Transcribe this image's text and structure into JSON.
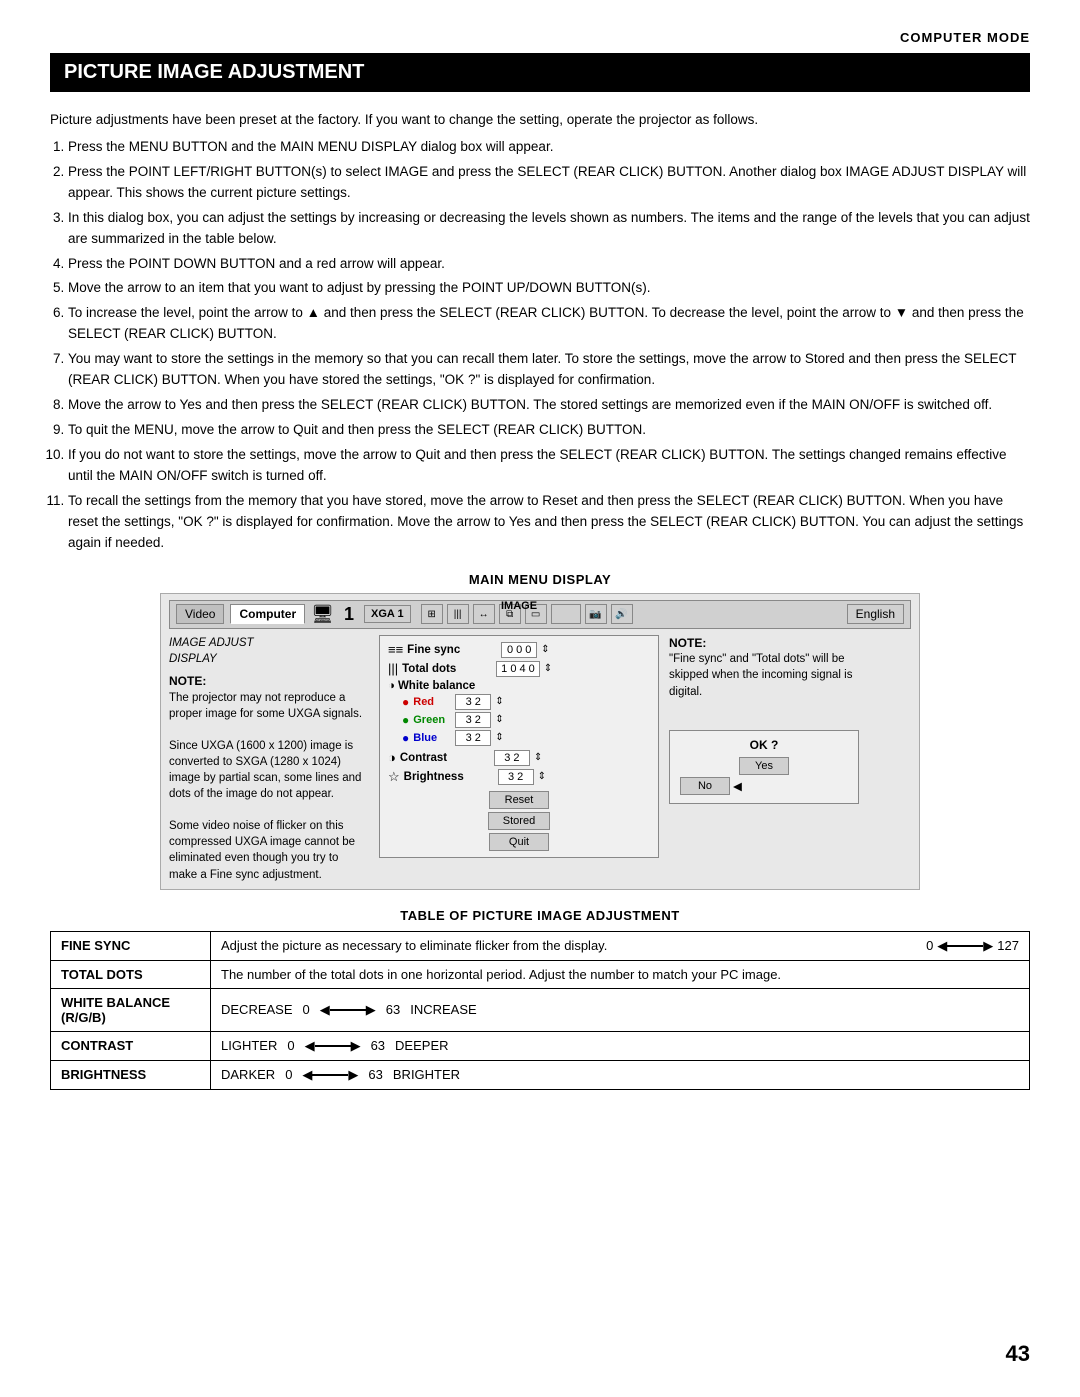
{
  "header": {
    "mode": "COMPUTER MODE"
  },
  "title": "PICTURE IMAGE ADJUSTMENT",
  "intro": "Picture adjustments have been preset at the factory.  If you want to change the setting, operate the projector as follows.",
  "steps": [
    "Press the MENU BUTTON and the MAIN MENU DISPLAY dialog box will appear.",
    "Press the POINT LEFT/RIGHT BUTTON(s) to select IMAGE and press the SELECT (REAR CLICK) BUTTON. Another dialog box IMAGE ADJUST DISPLAY will appear. This shows the current picture settings.",
    "In this dialog box, you can adjust the settings by increasing or decreasing the levels shown as numbers. The items and the range of the levels that you can adjust are summarized in the table below.",
    "Press the POINT DOWN BUTTON and a red arrow will appear.",
    "Move the arrow to an item that you want to adjust by pressing the POINT UP/DOWN BUTTON(s).",
    "To increase the level, point the arrow to ▲ and then press the SELECT (REAR CLICK) BUTTON. To decrease the level, point the arrow to ▼ and then press the SELECT (REAR CLICK) BUTTON.",
    "You may want to store the settings in the memory so that you can recall them later. To store the settings, move the arrow to Stored and then press the SELECT (REAR CLICK) BUTTON. When you have stored the settings, \"OK ?\" is displayed for confirmation.",
    "Move the arrow to Yes and then press the SELECT (REAR CLICK) BUTTON. The stored settings are memorized even if the MAIN ON/OFF is switched off.",
    "To quit the MENU, move the arrow to Quit and then press the SELECT (REAR CLICK) BUTTON.",
    "If you do not want to store the settings, move the arrow to Quit and then press the SELECT (REAR CLICK) BUTTON. The settings changed remains effective until the MAIN ON/OFF switch is turned off.",
    "To recall the settings from the memory that you have stored, move the arrow to Reset and then press the SELECT (REAR CLICK) BUTTON. When you have reset the settings, \"OK ?\" is displayed for confirmation. Move the arrow to Yes and then press  the SELECT (REAR CLICK) BUTTON. You can adjust the settings again if needed."
  ],
  "diagram": {
    "label": "MAIN MENU DISPLAY",
    "tabs": [
      "Video",
      "Computer"
    ],
    "active_tab": "Computer",
    "computer_num": "1",
    "xga": "XGA 1",
    "image_label": "IMAGE",
    "english": "English",
    "image_adjust_label": "IMAGE ADJUST\nDISPLAY",
    "adjust_items": [
      {
        "icon": "≡≡",
        "label": "Fine sync",
        "value": "0 0 0"
      },
      {
        "icon": "|||",
        "label": "Total dots",
        "value": "1 0 4 0"
      }
    ],
    "white_balance_label": "White balance",
    "wb_items": [
      {
        "color": "Red",
        "value": "3 2"
      },
      {
        "color": "Green",
        "value": "3 2"
      },
      {
        "color": "Blue",
        "value": "3 2"
      }
    ],
    "contrast": {
      "label": "Contrast",
      "value": "3 2"
    },
    "brightness": {
      "label": "Brightness",
      "value": "3 2"
    },
    "buttons": [
      "Reset",
      "Stored",
      "Quit"
    ],
    "ok_text": "OK ?",
    "yes_label": "Yes",
    "no_label": "No"
  },
  "left_note": {
    "title": "NOTE:",
    "text": "The projector may not reproduce a proper image for some UXGA signals.\nSince UXGA (1600 x 1200) image is converted to SXGA (1280 x 1024) image by partial scan, some lines and dots of the image do not appear.\nSome video noise of flicker on this compressed UXGA image cannot be eliminated even though you try to make a Fine sync adjustment."
  },
  "right_note": {
    "title": "NOTE:",
    "text": "\"Fine sync\" and \"Total dots\" will be skipped when the incoming signal is digital."
  },
  "table": {
    "label": "TABLE OF PICTURE IMAGE ADJUSTMENT",
    "rows": [
      {
        "header": "FINE SYNC",
        "desc": "Adjust the picture as necessary to eliminate flicker from the display.",
        "range_start": "0",
        "range_end": "127",
        "extra": ""
      },
      {
        "header": "TOTAL DOTS",
        "desc": "The number of the total dots in one horizontal period. Adjust the number to match your PC image.",
        "range_start": "",
        "range_end": "",
        "extra": ""
      },
      {
        "header": "WHITE BALANCE (R/G/B)",
        "desc": "DECREASE",
        "range_start": "0",
        "range_end": "63",
        "extra": "INCREASE"
      },
      {
        "header": "CONTRAST",
        "desc": "LIGHTER",
        "range_start": "0",
        "range_end": "63",
        "extra": "DEEPER"
      },
      {
        "header": "BRIGHTNESS",
        "desc": "DARKER",
        "range_start": "0",
        "range_end": "63",
        "extra": "BRIGHTER"
      }
    ]
  },
  "page_number": "43"
}
